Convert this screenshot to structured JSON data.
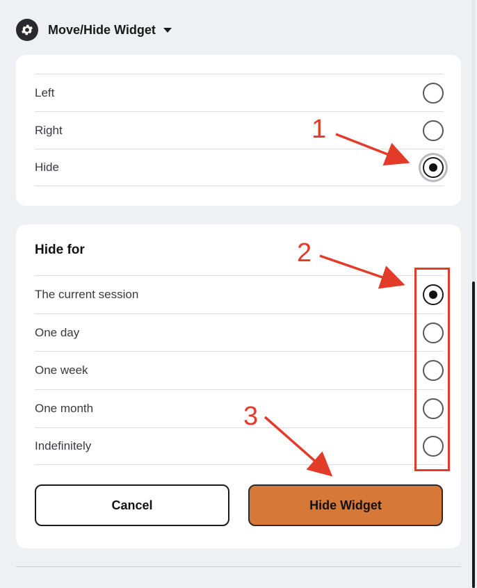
{
  "header": {
    "title": "Move/Hide Widget",
    "icon": "gear-icon"
  },
  "position_options": [
    {
      "label": "Left",
      "selected": false
    },
    {
      "label": "Right",
      "selected": false
    },
    {
      "label": "Hide",
      "selected": true
    }
  ],
  "hide_for": {
    "title": "Hide for",
    "options": [
      {
        "label": "The current session",
        "selected": true
      },
      {
        "label": "One day",
        "selected": false
      },
      {
        "label": "One week",
        "selected": false
      },
      {
        "label": "One month",
        "selected": false
      },
      {
        "label": "Indefinitely",
        "selected": false
      }
    ]
  },
  "buttons": {
    "cancel": "Cancel",
    "hide": "Hide Widget"
  },
  "annotations": {
    "step1": "1",
    "step2": "2",
    "step3": "3",
    "color": "#e23b2a"
  },
  "colors": {
    "accent": "#d57838",
    "background": "#eef0f4"
  }
}
